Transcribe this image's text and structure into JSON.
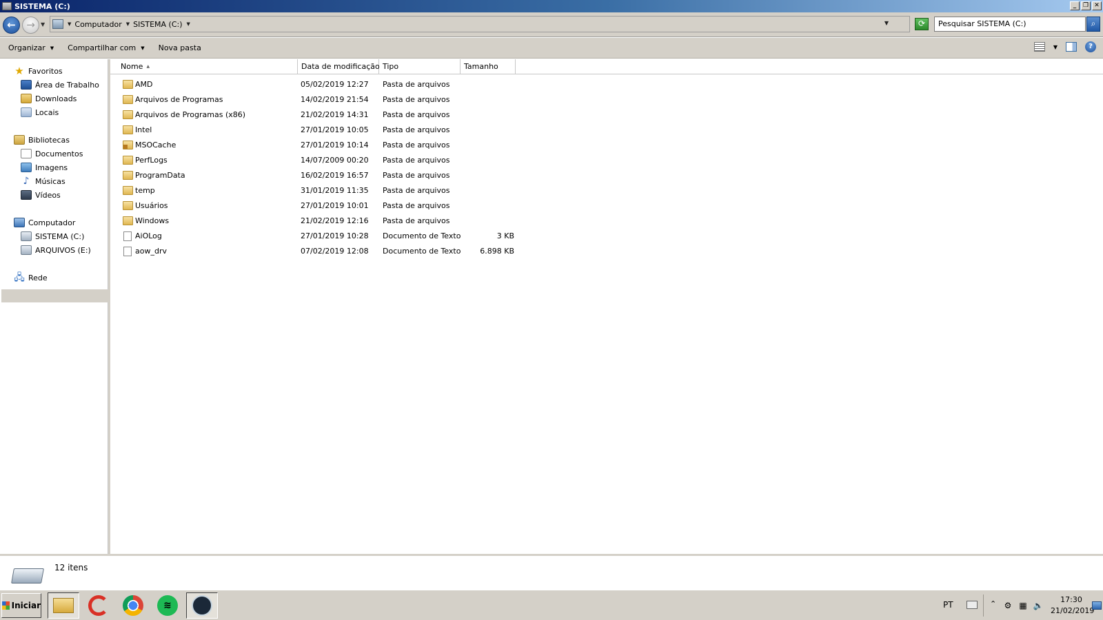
{
  "window": {
    "title": "SISTEMA (C:)"
  },
  "address": {
    "crumbs": [
      "Computador",
      "SISTEMA (C:)"
    ],
    "search_placeholder": "Pesquisar SISTEMA (C:)"
  },
  "toolbar": {
    "organize": "Organizar",
    "share": "Compartilhar com",
    "new_folder": "Nova pasta"
  },
  "nav": {
    "favorites": {
      "label": "Favoritos",
      "items": [
        "Área de Trabalho",
        "Downloads",
        "Locais"
      ]
    },
    "libraries": {
      "label": "Bibliotecas",
      "items": [
        "Documentos",
        "Imagens",
        "Músicas",
        "Vídeos"
      ]
    },
    "computer": {
      "label": "Computador",
      "items": [
        "SISTEMA (C:)",
        "ARQUIVOS (E:)"
      ]
    },
    "network": {
      "label": "Rede"
    }
  },
  "columns": {
    "name": "Nome",
    "modified": "Data de modificação",
    "type": "Tipo",
    "size": "Tamanho"
  },
  "files": [
    {
      "name": "AMD",
      "modified": "05/02/2019 12:27",
      "type": "Pasta de arquivos",
      "size": ""
    },
    {
      "name": "Arquivos de Programas",
      "modified": "14/02/2019 21:54",
      "type": "Pasta de arquivos",
      "size": ""
    },
    {
      "name": "Arquivos de Programas (x86)",
      "modified": "21/02/2019 14:31",
      "type": "Pasta de arquivos",
      "size": ""
    },
    {
      "name": "Intel",
      "modified": "27/01/2019 10:05",
      "type": "Pasta de arquivos",
      "size": ""
    },
    {
      "name": "MSOCache",
      "modified": "27/01/2019 10:14",
      "type": "Pasta de arquivos",
      "size": ""
    },
    {
      "name": "PerfLogs",
      "modified": "14/07/2009 00:20",
      "type": "Pasta de arquivos",
      "size": ""
    },
    {
      "name": "ProgramData",
      "modified": "16/02/2019 16:57",
      "type": "Pasta de arquivos",
      "size": ""
    },
    {
      "name": "temp",
      "modified": "31/01/2019 11:35",
      "type": "Pasta de arquivos",
      "size": ""
    },
    {
      "name": "Usuários",
      "modified": "27/01/2019 10:01",
      "type": "Pasta de arquivos",
      "size": ""
    },
    {
      "name": "Windows",
      "modified": "21/02/2019 12:16",
      "type": "Pasta de arquivos",
      "size": ""
    },
    {
      "name": "AiOLog",
      "modified": "27/01/2019 10:28",
      "type": "Documento de Texto",
      "size": "3 KB"
    },
    {
      "name": "aow_drv",
      "modified": "07/02/2019 12:08",
      "type": "Documento de Texto",
      "size": "6.898 KB"
    }
  ],
  "status": {
    "count": "12 itens"
  },
  "taskbar": {
    "start": "Iniciar",
    "lang": "PT",
    "time": "17:30",
    "date": "21/02/2019"
  }
}
